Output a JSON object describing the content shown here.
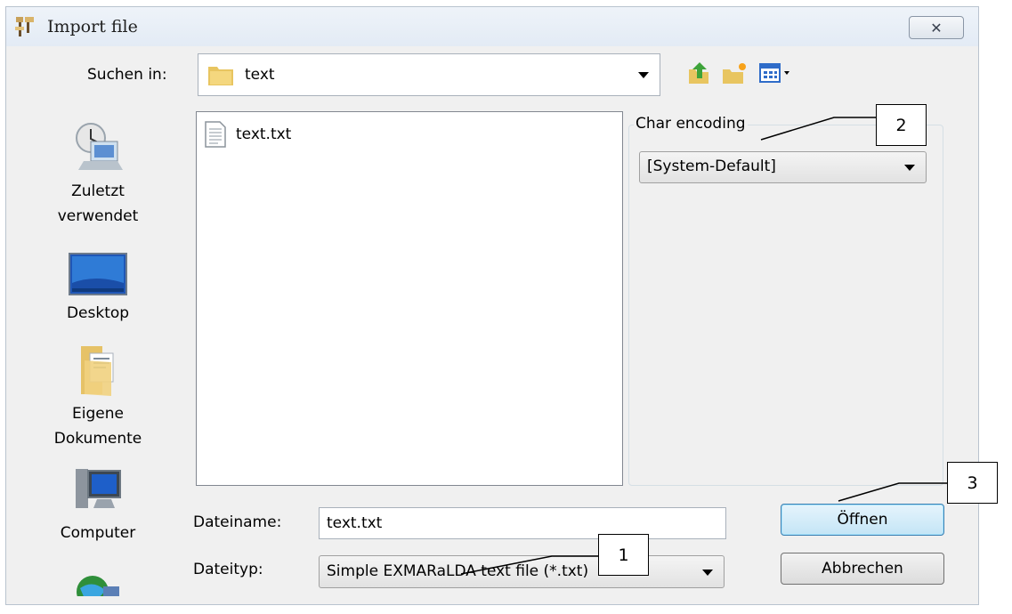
{
  "dialog": {
    "title": "Import file",
    "close_glyph": "✕"
  },
  "toolbar": {
    "look_in_label": "Suchen in:",
    "look_in_value": "text",
    "icons": [
      "folder-up-icon",
      "new-folder-icon",
      "view-menu-icon"
    ]
  },
  "places": [
    {
      "label_line1": "Zuletzt",
      "label_line2": "verwendet",
      "icon": "recent-places-icon"
    },
    {
      "label_line1": "Desktop",
      "label_line2": "",
      "icon": "desktop-icon"
    },
    {
      "label_line1": "Eigene",
      "label_line2": "Dokumente",
      "icon": "documents-icon"
    },
    {
      "label_line1": "Computer",
      "label_line2": "",
      "icon": "computer-icon"
    },
    {
      "label_line1": "",
      "label_line2": "",
      "icon": "network-icon"
    }
  ],
  "files": [
    {
      "name": "text.txt",
      "icon": "text-file-icon"
    }
  ],
  "encoding": {
    "legend": "Char encoding",
    "value": "[System-Default]"
  },
  "form": {
    "filename_label": "Dateiname:",
    "filename_value": "text.txt",
    "filetype_label": "Dateityp:",
    "filetype_value": "Simple EXMARaLDA text file (*.txt)"
  },
  "buttons": {
    "open": "Öffnen",
    "cancel": "Abbrechen"
  },
  "callouts": [
    "1",
    "2",
    "3"
  ]
}
